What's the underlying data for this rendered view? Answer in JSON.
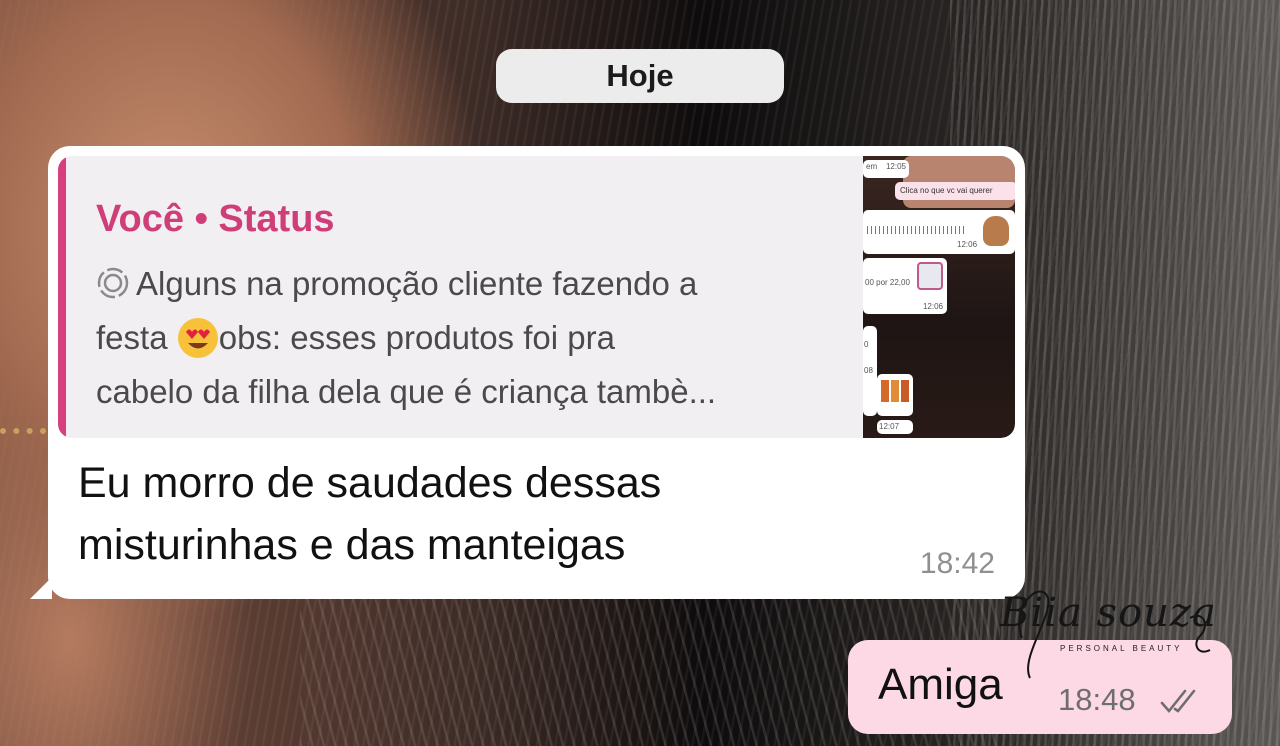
{
  "date_divider": {
    "label": "Hoje"
  },
  "incoming_message": {
    "quote": {
      "sender": "Você • Status",
      "snippet_lines": [
        "Alguns na promoção cliente fazendo a",
        "festa",
        "obs: esses produtos foi pra",
        "cabelo da filha dela que é criança tambè..."
      ],
      "status_icon": "status-ring-icon",
      "emoji": "heart-eyes-emoji",
      "thumbnail": {
        "bubbles": [
          {
            "text": "em",
            "time": "12:05"
          },
          {
            "text": "Clica no que vc vai querer"
          },
          {
            "text": "",
            "time": "12:06"
          },
          {
            "text": "00 por 22,00"
          },
          {
            "text": "",
            "time": "12:06"
          },
          {
            "text": "0"
          },
          {
            "text": "08"
          },
          {
            "text": "",
            "time": "12:07"
          }
        ]
      }
    },
    "text_lines": [
      "Eu morro de saudades dessas",
      "misturinhas e das manteigas"
    ],
    "time": "18:42"
  },
  "outgoing_message": {
    "text": "Amiga",
    "time": "18:48",
    "status_icon": "double-check-icon"
  },
  "watermark": {
    "name": "Biia souza",
    "subtitle": "PERSONAL BEAUTY"
  },
  "colors": {
    "quote_accent": "#cf3e78",
    "outgoing_bubble": "#fcd9e5",
    "incoming_bubble": "#ffffff",
    "date_pill": "#ececec"
  }
}
